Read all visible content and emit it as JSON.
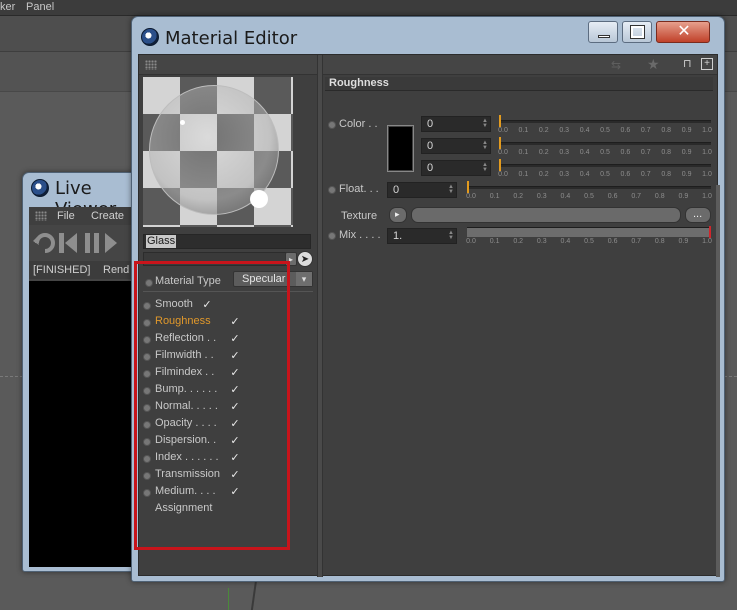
{
  "background_app": {
    "menu": [
      "ker",
      "Panel"
    ]
  },
  "live_viewer": {
    "title": "Live Viewer",
    "menu": [
      "File",
      "Create"
    ],
    "status": "[FINISHED]",
    "status_tail": "Rend"
  },
  "material_editor": {
    "title": "Material Editor",
    "material_name": "Glass",
    "material_type": {
      "label": "Material Type",
      "value": "Specular"
    },
    "channels": [
      {
        "label": "Smooth",
        "checked": true,
        "active": false
      },
      {
        "label": "Roughness",
        "checked": true,
        "active": true
      },
      {
        "label": "Reflection . .",
        "checked": true,
        "active": false
      },
      {
        "label": "Filmwidth . .",
        "checked": true,
        "active": false
      },
      {
        "label": "Filmindex . .",
        "checked": true,
        "active": false
      },
      {
        "label": "Bump. . . . . .",
        "checked": true,
        "active": false
      },
      {
        "label": "Normal. . . . .",
        "checked": true,
        "active": false
      },
      {
        "label": "Opacity . . . .",
        "checked": true,
        "active": false
      },
      {
        "label": "Dispersion. .",
        "checked": true,
        "active": false
      },
      {
        "label": "Index . . . . . .",
        "checked": true,
        "active": false
      },
      {
        "label": "Transmission",
        "checked": true,
        "active": false
      },
      {
        "label": "Medium. . . .",
        "checked": true,
        "active": false
      },
      {
        "label": "Assignment",
        "checked": null,
        "active": false
      }
    ],
    "check_glyph": "✓",
    "section_title": "Roughness",
    "color": {
      "label": "Color . .",
      "swatch": "#000000",
      "values": [
        "0",
        "0",
        "0"
      ],
      "levels": [
        0.0,
        0.0,
        0.0
      ]
    },
    "float": {
      "label": "Float. . .",
      "value": "0",
      "level": 0.0
    },
    "texture": {
      "label": "Texture",
      "browse": "..."
    },
    "mix": {
      "label": "Mix . . . .",
      "value": "1.",
      "level": 1.0
    },
    "ticks": [
      "0.0",
      "0.1",
      "0.2",
      "0.3",
      "0.4",
      "0.5",
      "0.6",
      "0.7",
      "0.8",
      "0.9",
      "1.0"
    ],
    "colors": {
      "active_channel": "#e0982b",
      "slider_knob": "#e39b1e",
      "mix_knob": "#d0262c",
      "annotation": "#c8141b"
    }
  }
}
